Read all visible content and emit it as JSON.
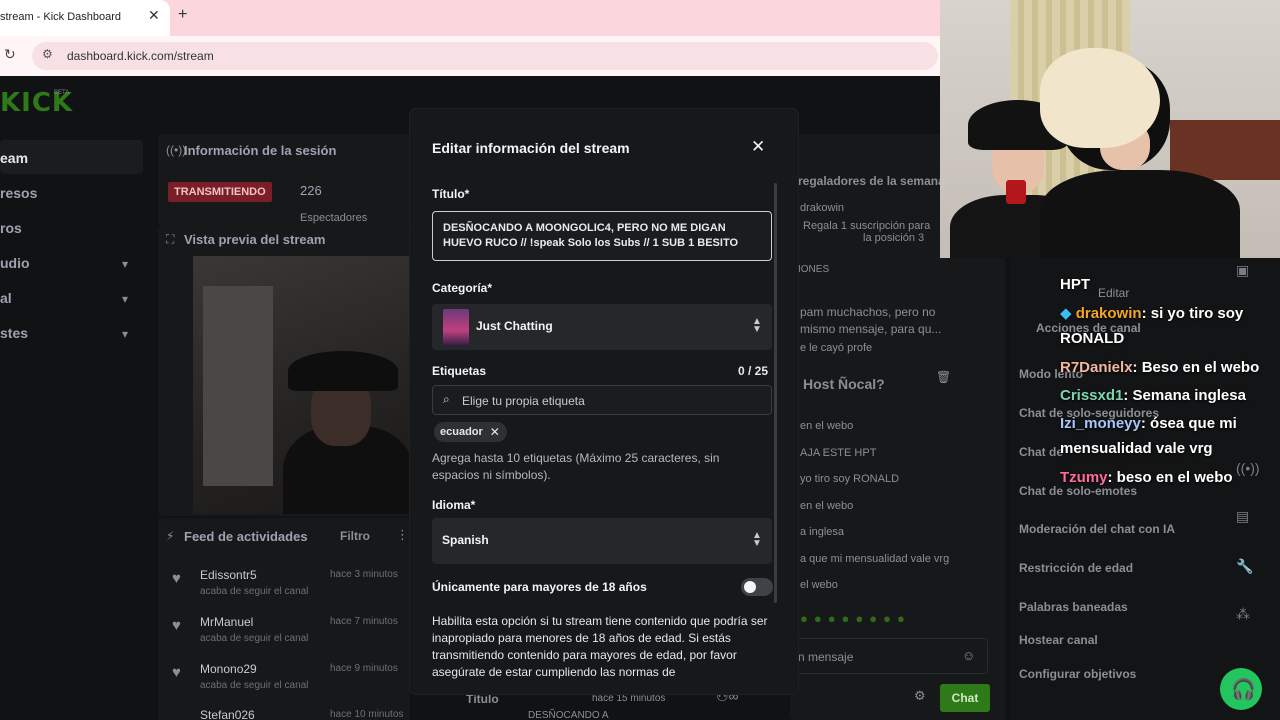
{
  "browser": {
    "tab_title": "stream - Kick Dashboard",
    "tab_close": "✕",
    "new_tab": "+",
    "url": "dashboard.kick.com/stream"
  },
  "sidebar": {
    "logo": "KICK",
    "logo_badge": "BETA",
    "items": [
      {
        "label": "eam"
      },
      {
        "label": "resos"
      },
      {
        "label": "ros"
      },
      {
        "label": "udio"
      },
      {
        "label": "al"
      },
      {
        "label": "stes"
      }
    ]
  },
  "session": {
    "title": "Información de la sesión",
    "live_badge": "TRANSMITIENDO",
    "viewers": "226",
    "viewers_label": "Espectadores"
  },
  "preview": {
    "title": "Vista previa del stream"
  },
  "feed": {
    "title": "Feed de actividades",
    "filter": "Filtro",
    "items": [
      {
        "name": "Edissontr5",
        "action": "acaba de seguir el canal",
        "time": "hace 3 minutos"
      },
      {
        "name": "MrManuel",
        "action": "acaba de seguir el canal",
        "time": "hace 7 minutos"
      },
      {
        "name": "Monono29",
        "action": "acaba de seguir el canal",
        "time": "hace 9 minutos"
      },
      {
        "name": "Stefan026",
        "action": "",
        "time": "hace 10 minutos"
      }
    ]
  },
  "bottom_bar": {
    "title_label": "Título",
    "time": "hace 15 minutos",
    "value": "DESÑOCANDO A",
    "chat_button": "Chat"
  },
  "center_chat": {
    "gifters_title": "regaladores de la semana",
    "gifter": "drakowin",
    "gifter_desc": "Regala 1 suscripción para",
    "gifter_desc2": "la posición 3",
    "pinned_label": "IONES",
    "pinned_text": "pam muchachos, pero no",
    "pinned_text2": "mismo mensaje, para qu...",
    "pinned_text3": "e le cayó profe",
    "host_name": "Host Ñocal?",
    "lines": [
      "en el webo",
      "AJA ESTE HPT",
      "yo tiro soy RONALD",
      "en el webo",
      "a inglesa",
      "a que mi mensualidad vale vrg",
      "el webo"
    ],
    "input_placeholder": "n mensaje"
  },
  "right_panel": {
    "edit": "Editar",
    "actions_title": "Acciones de canal",
    "items": [
      "Modo lento",
      "Chat de solo-seguidores",
      "Chat de",
      "Chat de solo-emotes",
      "Moderación del chat con IA",
      "Restricción de edad",
      "Palabras baneadas",
      "Hostear canal",
      "Configurar objetivos"
    ]
  },
  "modal": {
    "title": "Editar información del stream",
    "close": "✕",
    "title_label": "Título*",
    "title_value": "DESÑOCANDO A MOONGOLIC4, PERO NO ME DIGAN HUEVO RUCO // !speak Solo los Subs // 1 SUB 1 BESITO",
    "category_label": "Categoría*",
    "category_value": "Just Chatting",
    "tags_label": "Etiquetas",
    "tags_counter": "0 / 25",
    "tags_placeholder": "Elige tu propia etiqueta",
    "tags": [
      "ecuador"
    ],
    "tags_help": "Agrega hasta 10 etiquetas (Máximo 25 caracteres, sin espacios ni símbolos).",
    "language_label": "Idioma*",
    "language_value": "Spanish",
    "adult_label": "Únicamente para mayores de 18 años",
    "adult_enabled": false,
    "adult_help": "Habilita esta opción si tu stream tiene contenido que podría ser inapropiado para menores de 18 años de edad. Si estás transmitiendo contenido para mayores de edad, por favor asegúrate de estar cumpliendo las normas de"
  },
  "overlay_chat": {
    "lines": [
      {
        "user": "HPT",
        "color": "#ffffff",
        "text": ""
      },
      {
        "user": "drakowin",
        "color": "#f5a623",
        "text": ": si yo tiro soy RONALD",
        "badge": true
      },
      {
        "user": "R7Danielx",
        "color": "#f2b8a0",
        "text": ": Beso en el webo"
      },
      {
        "user": "Crissxd1",
        "color": "#7fd4b0",
        "text": ": Semana inglesa"
      },
      {
        "user": "Izi_moneyy",
        "color": "#a9c7ff",
        "text": ": ósea que mi mensualidad vale vrg"
      },
      {
        "user": "Tzumy",
        "color": "#ff6b9d",
        "text": ": beso en el webo"
      }
    ]
  }
}
